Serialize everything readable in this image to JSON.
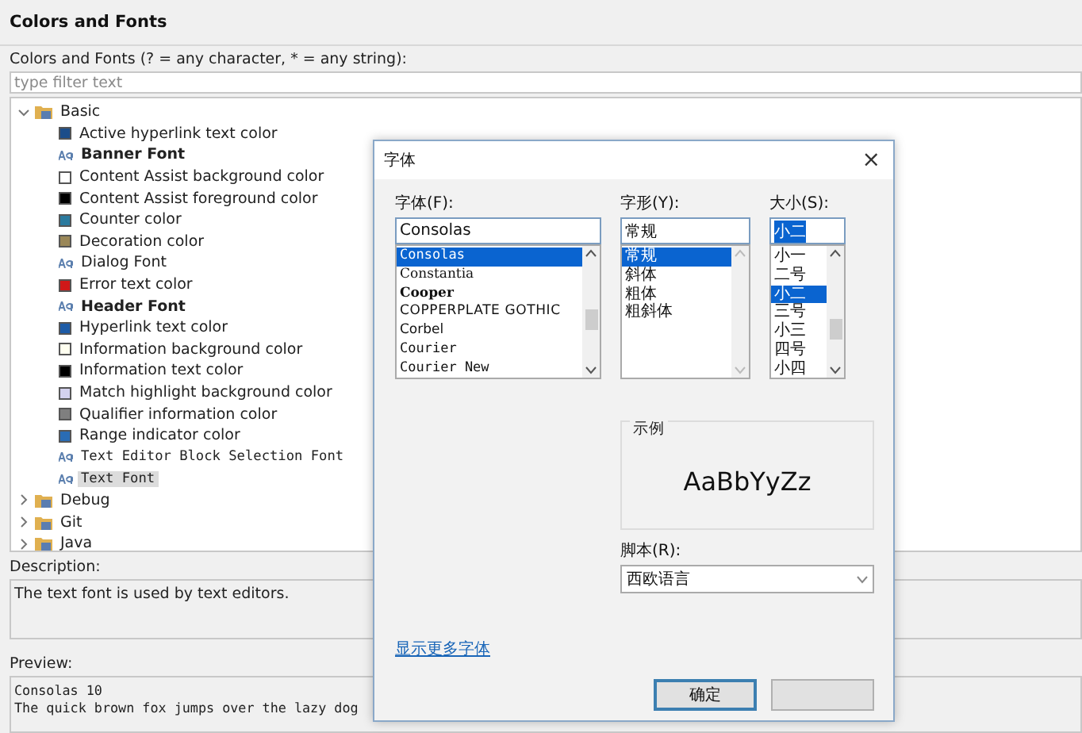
{
  "page": {
    "title": "Colors and Fonts",
    "filter_label": "Colors and Fonts (? = any character, * = any string):",
    "filter": {
      "placeholder": "type filter text"
    }
  },
  "tree": [
    {
      "label": "Basic",
      "expanded": true,
      "children": [
        {
          "label": "Active hyperlink text color",
          "kind": "color",
          "color": "#1b4d8a",
          "selected": false
        },
        {
          "label": "Banner Font",
          "kind": "bold-font",
          "selected": false
        },
        {
          "label": "Content Assist background color",
          "kind": "color",
          "color": "#ffffff",
          "selected": false
        },
        {
          "label": "Content Assist foreground color",
          "kind": "color",
          "color": "#000000",
          "selected": false
        },
        {
          "label": "Counter color",
          "kind": "color",
          "color": "#2b7a9e",
          "selected": false
        },
        {
          "label": "Decoration color",
          "kind": "color",
          "color": "#9a8758",
          "selected": false
        },
        {
          "label": "Dialog Font",
          "kind": "font",
          "selected": false
        },
        {
          "label": "Error text color",
          "kind": "color",
          "color": "#d01818",
          "selected": false
        },
        {
          "label": "Header Font",
          "kind": "bold-font",
          "selected": false
        },
        {
          "label": "Hyperlink text color",
          "kind": "color",
          "color": "#1d5ba6",
          "selected": false
        },
        {
          "label": "Information background color",
          "kind": "color",
          "color": "#fffff0",
          "selected": false
        },
        {
          "label": "Information text color",
          "kind": "color",
          "color": "#000000",
          "selected": false
        },
        {
          "label": "Match highlight background color",
          "kind": "color",
          "color": "#d4d2ee",
          "selected": false
        },
        {
          "label": "Qualifier information color",
          "kind": "color",
          "color": "#7f7f7f",
          "selected": false
        },
        {
          "label": "Range indicator color",
          "kind": "color",
          "color": "#2a6cb4",
          "selected": false
        },
        {
          "label": "Text Editor Block Selection Font",
          "kind": "mono-font",
          "selected": false
        },
        {
          "label": "Text Font",
          "kind": "mono-font",
          "selected": true
        }
      ]
    },
    {
      "label": "Debug",
      "expanded": false
    },
    {
      "label": "Git",
      "expanded": false
    },
    {
      "label": "Java",
      "expanded": false
    }
  ],
  "description": {
    "label": "Description:",
    "text": "The text font is used by text editors."
  },
  "preview": {
    "label": "Preview:",
    "lines": [
      "Consolas 10",
      "The quick brown fox jumps over the lazy dog"
    ]
  },
  "dialog": {
    "title": "字体",
    "close": "×",
    "font": {
      "label": "字体(F):",
      "value": "Consolas",
      "items": [
        {
          "label": "Consolas",
          "kind": "mono",
          "selected": true
        },
        {
          "label": "Constantia",
          "kind": "serif",
          "selected": false
        },
        {
          "label": "Cooper",
          "kind": "bold",
          "selected": false
        },
        {
          "label": "COPPERPLATE GOTHIC",
          "kind": "caps",
          "selected": false
        },
        {
          "label": "Corbel",
          "kind": "sans",
          "selected": false
        },
        {
          "label": "Courier",
          "kind": "mono",
          "selected": false
        },
        {
          "label": "Courier New",
          "kind": "mono",
          "selected": false
        }
      ]
    },
    "style": {
      "label": "字形(Y):",
      "value": "常规",
      "items": [
        {
          "label": "常规",
          "selected": true
        },
        {
          "label": "斜体",
          "selected": false
        },
        {
          "label": "粗体",
          "selected": false
        },
        {
          "label": "粗斜体",
          "selected": false
        }
      ]
    },
    "size": {
      "label": "大小(S):",
      "value": "小二",
      "items": [
        {
          "label": "小一",
          "selected": false
        },
        {
          "label": "二号",
          "selected": false
        },
        {
          "label": "小二",
          "selected": true
        },
        {
          "label": "三号",
          "selected": false
        },
        {
          "label": "小三",
          "selected": false
        },
        {
          "label": "四号",
          "selected": false
        },
        {
          "label": "小四",
          "selected": false
        }
      ]
    },
    "sample": {
      "label": "示例",
      "text": "AaBbYyZz"
    },
    "script": {
      "label": "脚本(R):",
      "value": "西欧语言"
    },
    "link": "显示更多字体",
    "buttons": [
      {
        "label": "确定",
        "kind": "default"
      },
      {
        "kind": "plain"
      }
    ]
  }
}
